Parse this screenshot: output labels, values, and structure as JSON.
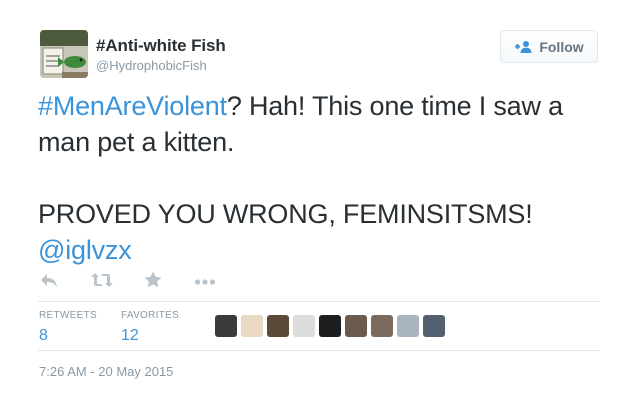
{
  "user": {
    "display_name": "#Anti-white Fish",
    "handle": "@HydrophobicFish"
  },
  "follow_button": {
    "label": "Follow",
    "icon": "add-user-icon"
  },
  "tweet": {
    "segments": [
      {
        "text": "#MenAreViolent",
        "type": "hashtag"
      },
      {
        "text": "? Hah! This one time I saw a man pet a kitten.\n\nPROVED YOU WRONG, FEMINSITSMS!\n",
        "type": "text"
      },
      {
        "text": "@iglvzx",
        "type": "mention"
      }
    ]
  },
  "actions": [
    {
      "name": "reply-icon"
    },
    {
      "name": "retweet-icon"
    },
    {
      "name": "favorite-icon"
    },
    {
      "name": "more-icon"
    }
  ],
  "stats": {
    "retweets": {
      "label": "RETWEETS",
      "value": "8"
    },
    "favorites": {
      "label": "FAVORITES",
      "value": "12"
    }
  },
  "favoriters": [
    {
      "color": "#3a3a3a"
    },
    {
      "color": "#e9d9c4"
    },
    {
      "color": "#5b4a3a"
    },
    {
      "color": "#dddddd"
    },
    {
      "color": "#1d1d1d"
    },
    {
      "color": "#6b5a4e"
    },
    {
      "color": "#7d6a5a"
    },
    {
      "color": "#a8b4bf"
    },
    {
      "color": "#526070"
    }
  ],
  "timestamp": "7:26 AM - 20 May 2015",
  "colors": {
    "link": "#3b94d9",
    "text": "#292f33",
    "muted": "#8899a6",
    "border": "#e1e8ed"
  }
}
